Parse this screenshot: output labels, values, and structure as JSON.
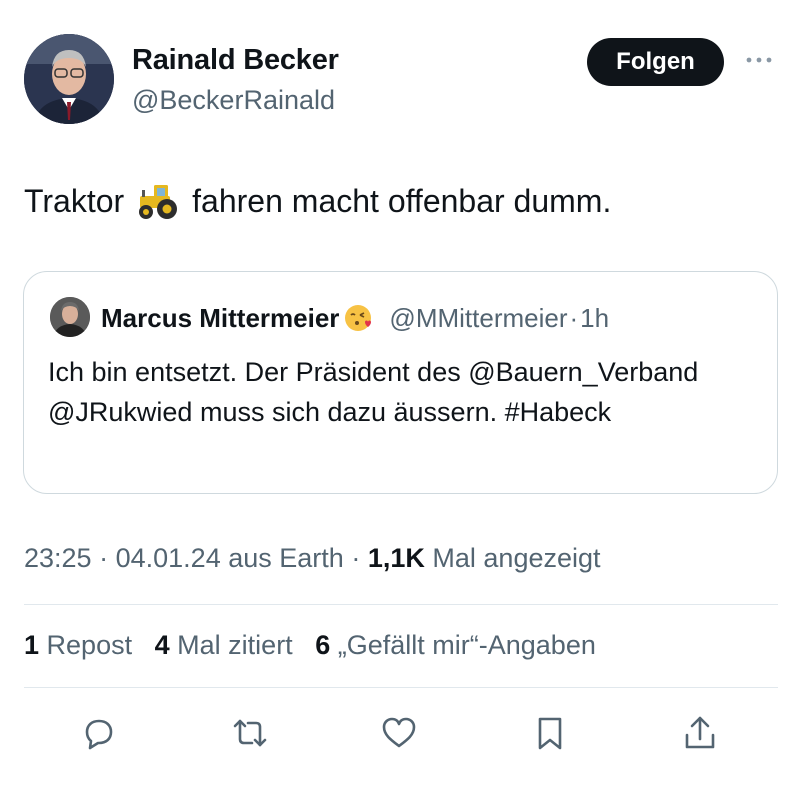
{
  "author": {
    "name": "Rainald Becker",
    "handle": "@BeckerRainald",
    "follow_label": "Folgen"
  },
  "tweet": {
    "text_before": "Traktor",
    "text_after": "fahren macht offenbar dumm.",
    "emoji": "tractor-emoji"
  },
  "quote": {
    "name": "Marcus Mittermeier",
    "emoji": "kissing-heart-emoji",
    "handle": "@MMittermeier",
    "separator": "·",
    "time": "1h",
    "text": "Ich bin entsetzt. Der Präsident des @Bauern_Verband @JRukwied muss sich dazu äussern. #Habeck"
  },
  "meta": {
    "time": "23:25",
    "date": "04.01.24",
    "source": "aus Earth",
    "views_count": "1,1K",
    "views_label": "Mal angezeigt",
    "separator": "·"
  },
  "stats": {
    "reposts_count": "1",
    "reposts_label": "Repost",
    "quotes_count": "4",
    "quotes_label": "Mal zitiert",
    "likes_count": "6",
    "likes_label": "„Gefällt mir“-Angaben"
  },
  "actions": [
    "reply-icon",
    "retweet-icon",
    "like-icon",
    "bookmark-icon",
    "share-icon"
  ],
  "colors": {
    "text": "#0f1419",
    "secondary": "#536471",
    "border": "#cfd9de",
    "button": "#0f1419"
  }
}
